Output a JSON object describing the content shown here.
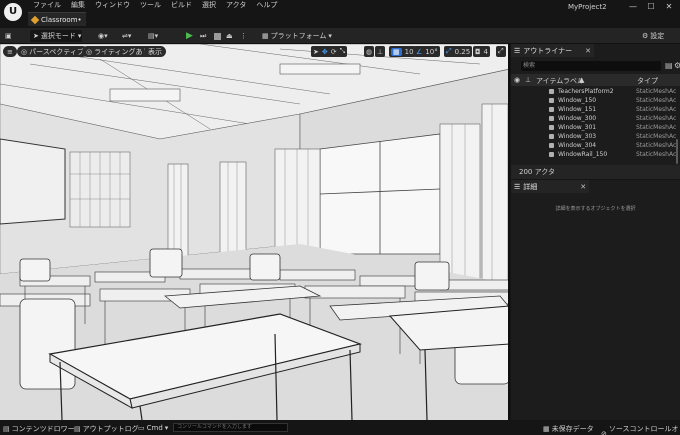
{
  "app": {
    "logo_letter": "U",
    "project_name": "MyProject2",
    "menu": [
      "ファイル",
      "編集",
      "ウィンドウ",
      "ツール",
      "ビルド",
      "選択",
      "アクタ",
      "ヘルプ"
    ],
    "tab_label": "Classroom•"
  },
  "window_controls": {
    "minimize": "—",
    "maximize": "☐",
    "close": "✕"
  },
  "toolbar": {
    "mode_label": "選択モード",
    "platform_label": "プラットフォーム",
    "settings_label": "設定"
  },
  "viewport": {
    "menu_icon": "≡",
    "perspective_label": "パースペクティブ",
    "lighting_label": "ライティングあり",
    "show_label": "表示",
    "grid_snap_value": "10",
    "rotation_snap_value": "10°",
    "scale_snap_value": "0.25",
    "camera_speed_value": "4"
  },
  "outliner": {
    "title": "アウトライナー",
    "search_placeholder": "検索",
    "col_item_label": "アイテムラベル",
    "col_type": "タイプ",
    "rows": [
      {
        "name": "TeachersPlatform2",
        "type": "StaticMeshAc"
      },
      {
        "name": "Window_150",
        "type": "StaticMeshAc"
      },
      {
        "name": "Window_151",
        "type": "StaticMeshAc"
      },
      {
        "name": "Window_300",
        "type": "StaticMeshAc"
      },
      {
        "name": "Window_301",
        "type": "StaticMeshAc"
      },
      {
        "name": "Window_303",
        "type": "StaticMeshAc"
      },
      {
        "name": "Window_304",
        "type": "StaticMeshAc"
      },
      {
        "name": "WindowRail_150",
        "type": "StaticMeshAc"
      }
    ],
    "actor_count": "200 アクタ"
  },
  "details": {
    "title": "詳細",
    "empty_message": "詳細を表示するオブジェクトを選択"
  },
  "bottombar": {
    "content_drawer": "コンテンツドロワー",
    "output_log": "アウトプットログ",
    "cmd_label": "Cmd",
    "console_placeholder": "コンソールコマンドを入力します",
    "unsaved_data": "未保存データ",
    "source_control": "ソースコントロールオフ"
  },
  "colors": {
    "background": "#151515",
    "panel": "#1c1c1c",
    "accent_blue": "#2f6fd0",
    "play_green": "#4cbb4c",
    "tab_orange": "#e0a030"
  }
}
